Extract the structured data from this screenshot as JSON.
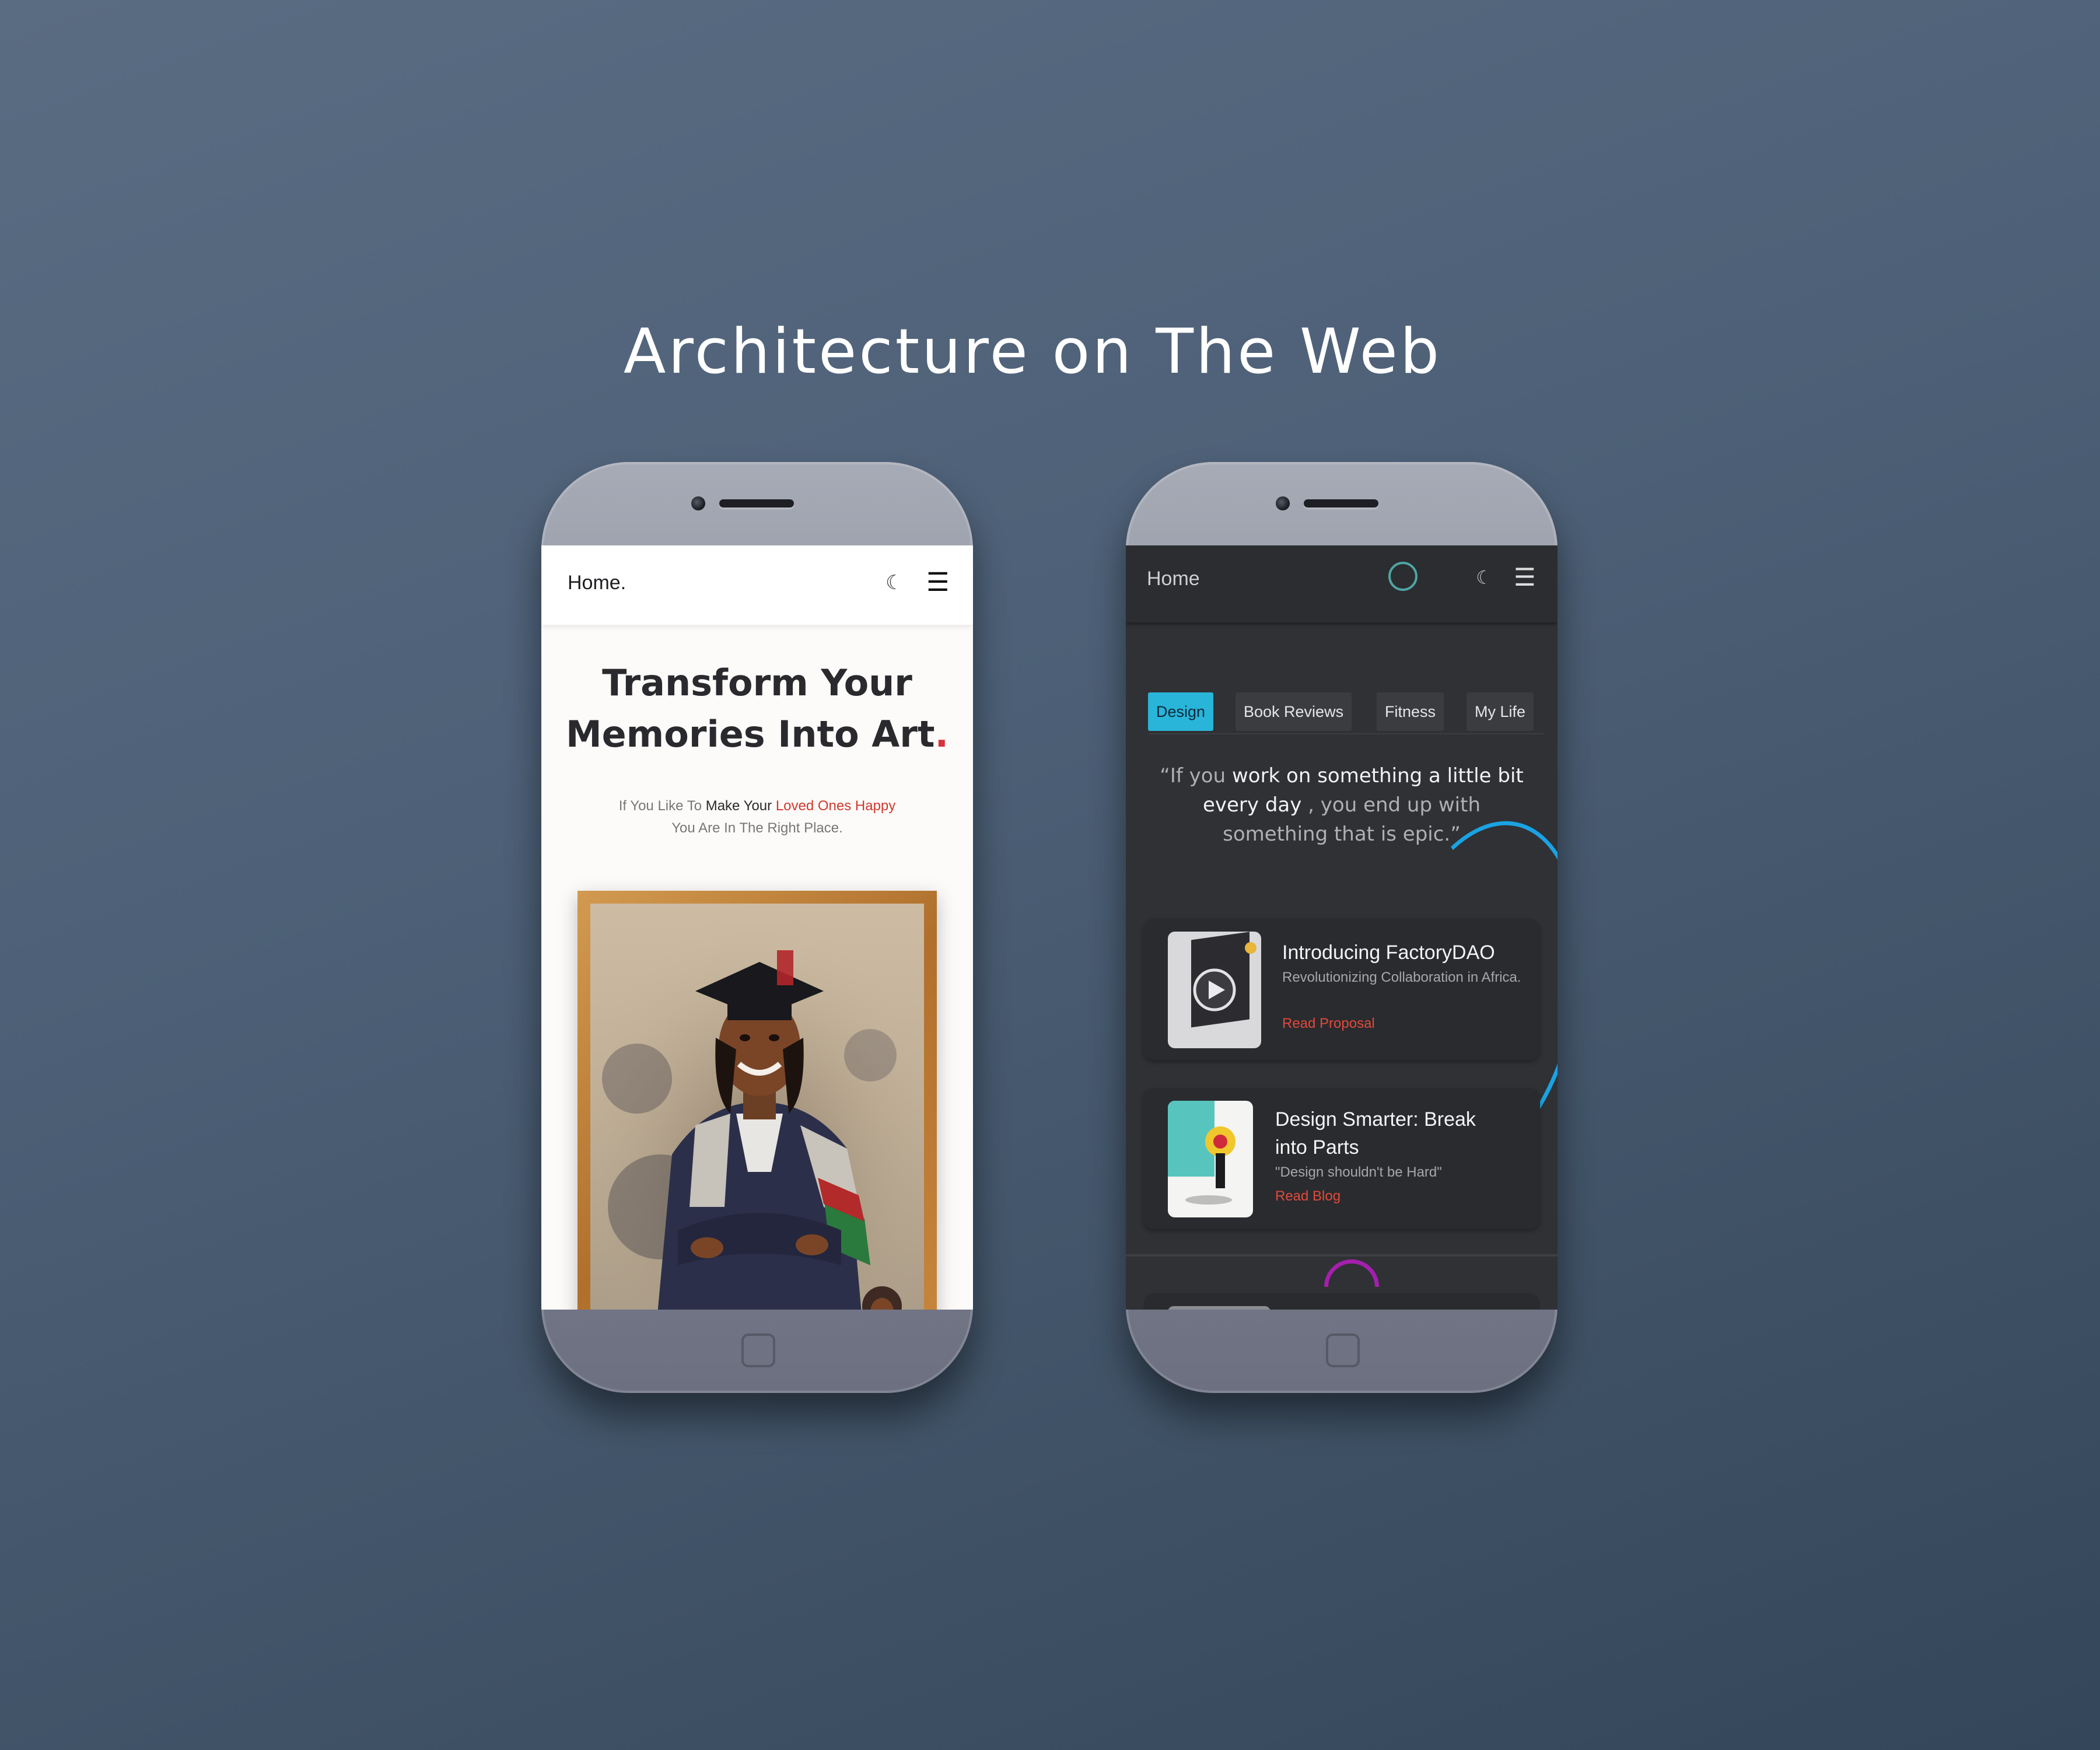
{
  "headline": "Architecture on The Web",
  "left_phone": {
    "nav": {
      "logo": "Home.",
      "theme_icon": "moon-icon",
      "menu_icon": "hamburger-icon"
    },
    "hero": {
      "title_line1": "Transform Your",
      "title_line2": "Memories Into Art",
      "title_dot": ".",
      "sub_part1": "If You Like To ",
      "sub_part2": "Make Your ",
      "sub_part3": "Loved Ones Happy",
      "sub_line2": "You Are In The Right Place."
    },
    "image": "framed-graduation-portrait"
  },
  "right_phone": {
    "nav": {
      "logo": "Home",
      "status_icon": "ring-icon",
      "theme_icon": "moon-icon",
      "menu_icon": "hamburger-icon"
    },
    "tabs": [
      {
        "label": "Design",
        "active": true
      },
      {
        "label": "Book Reviews",
        "active": false
      },
      {
        "label": "Fitness",
        "active": false
      },
      {
        "label": "My Life",
        "active": false
      }
    ],
    "quote": {
      "open": "“If you ",
      "bold1": "work on something a little bit",
      "bold2": "every day",
      "rest1": " , you end up with",
      "rest2": "something that is epic.”"
    },
    "cards": [
      {
        "title": "Introducing FactoryDAO",
        "desc": "Revolutionizing Collaboration in Africa.",
        "link": "Read Proposal",
        "thumb": "video-thumbnail-play-icon"
      },
      {
        "title_line1": "Design Smarter: Break",
        "title_line2": "into Parts",
        "desc": "\"Design shouldn't be Hard\"",
        "link": "Read Blog",
        "thumb": "illustration-thumbnail"
      }
    ]
  },
  "colors": {
    "accent_blue": "#29b4d9",
    "accent_red": "#d0392e",
    "accent_purple": "#a51fae"
  }
}
